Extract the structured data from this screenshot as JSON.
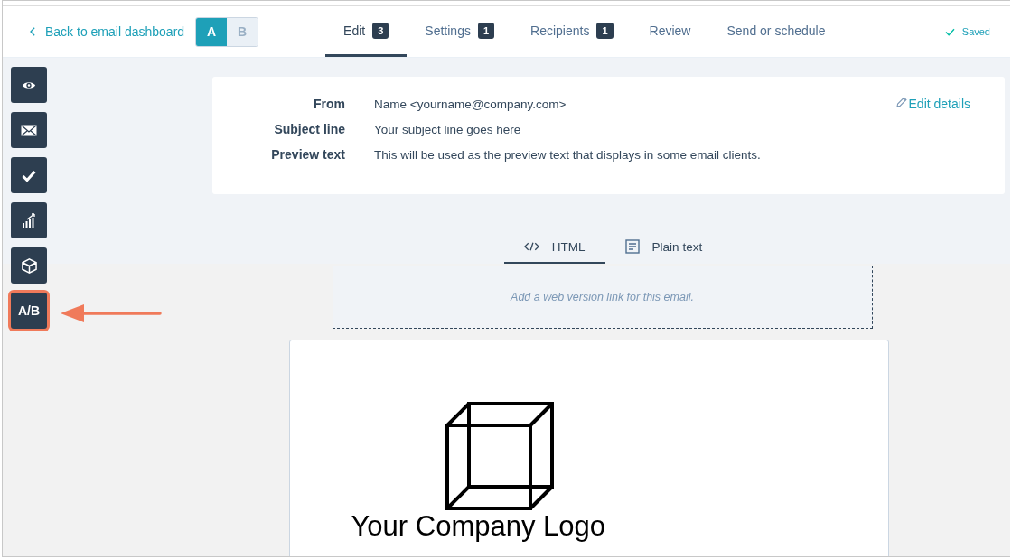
{
  "header": {
    "back_link": "Back to email dashboard",
    "variants": [
      {
        "label": "A",
        "selected": true
      },
      {
        "label": "B",
        "selected": false
      }
    ],
    "steps": [
      {
        "label": "Edit",
        "count": "3",
        "selected": true
      },
      {
        "label": "Settings",
        "count": "1",
        "selected": false
      },
      {
        "label": "Recipients",
        "count": "1",
        "selected": false
      },
      {
        "label": "Review",
        "selected": false
      },
      {
        "label": "Send or schedule",
        "selected": false
      }
    ],
    "status": "Saved"
  },
  "sidebar": {
    "items": [
      {
        "kind": "eye",
        "highlighted": false
      },
      {
        "kind": "envelope",
        "highlighted": false
      },
      {
        "kind": "check",
        "highlighted": false
      },
      {
        "kind": "chart",
        "highlighted": false
      },
      {
        "kind": "cube",
        "highlighted": false
      },
      {
        "kind": "text",
        "label": "A/B",
        "highlighted": true
      }
    ]
  },
  "details": {
    "fields": [
      {
        "label": "From",
        "value": "Name <yourname@company.com>"
      },
      {
        "label": "Subject line",
        "value": "Your subject line goes here"
      },
      {
        "label": "Preview text",
        "value": "This will be used as the preview text that displays in some email clients."
      }
    ],
    "edit_link": "Edit details"
  },
  "view_tabs": [
    {
      "kind": "code",
      "label": "HTML",
      "selected": true
    },
    {
      "kind": "doc",
      "label": "Plain text",
      "selected": false
    }
  ],
  "web_version_placeholder": "Add a web version link for this email.",
  "email": {
    "logo_text": "Your Company Logo"
  }
}
